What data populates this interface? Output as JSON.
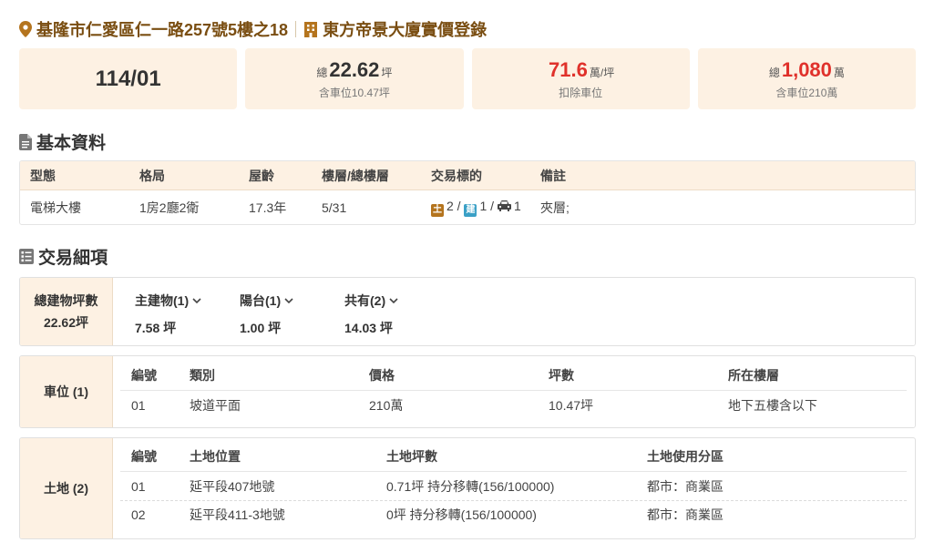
{
  "header": {
    "address": "基隆市仁愛區仁一路257號5樓之18",
    "building": "東方帝景大廈實價登錄",
    "address_icon": "map-pin-icon",
    "building_icon": "building-icon",
    "accent_color": "#b4741e"
  },
  "stats": {
    "date": "114/01",
    "area_prefix": "總",
    "area_value": "22.62",
    "area_unit": "坪",
    "area_sub": "含車位10.47坪",
    "unit_price_value": "71.6",
    "unit_price_unit": "萬/坪",
    "unit_price_sub": "扣除車位",
    "total_prefix": "總",
    "total_value": "1,080",
    "total_unit": "萬",
    "total_sub": "含車位210萬",
    "highlight_color": "#e0312b"
  },
  "basic": {
    "title": "基本資料",
    "headers": [
      "型態",
      "格局",
      "屋齡",
      "樓層/總樓層",
      "交易標的",
      "備註"
    ],
    "type": "電梯大樓",
    "layout": "1房2廳2衛",
    "age": "17.3年",
    "floor": "5/31",
    "target_land_tag": "土",
    "target_land": "2 /",
    "target_bld_tag": "建",
    "target_bld": "1 /",
    "target_car": "1",
    "note": "夾層;"
  },
  "detail": {
    "title": "交易細項",
    "total_area_label": "總建物坪數",
    "total_area_value": "22.62坪",
    "items": [
      {
        "label": "主建物(1)",
        "value": "7.58 坪"
      },
      {
        "label": "陽台(1)",
        "value": "1.00 坪"
      },
      {
        "label": "共有(2)",
        "value": "14.03 坪"
      }
    ]
  },
  "parking": {
    "label": "車位 (1)",
    "headers": [
      "編號",
      "類別",
      "價格",
      "坪數",
      "所在樓層"
    ],
    "rows": [
      [
        "01",
        "坡道平面",
        "210萬",
        "10.47坪",
        "地下五樓含以下"
      ]
    ]
  },
  "land": {
    "label": "土地 (2)",
    "headers": [
      "編號",
      "土地位置",
      "土地坪數",
      "土地使用分區"
    ],
    "rows": [
      [
        "01",
        "延平段407地號",
        "0.71坪 持分移轉(156/100000)",
        "都市：商業區"
      ],
      [
        "02",
        "延平段411-3地號",
        "0坪 持分移轉(156/100000)",
        "都市：商業區"
      ]
    ]
  }
}
